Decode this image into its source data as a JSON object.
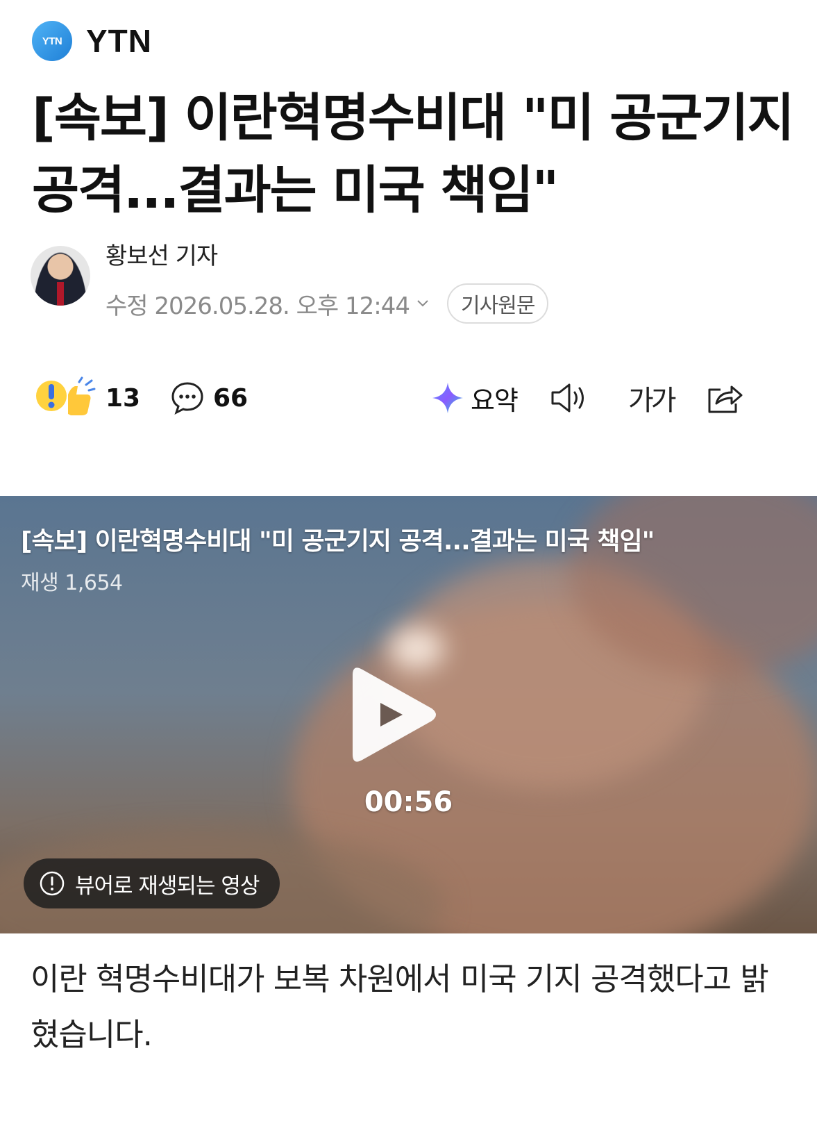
{
  "press": {
    "logo_text": "YTN",
    "name": "YTN",
    "brand_color": "#2a93e6"
  },
  "article": {
    "headline": "[속보] 이란혁명수비대 \"미 공군기지 공격...결과는 미국 책임\"",
    "reporter": "황보선 기자",
    "date": "수정 2026.05.28. 오후 12:44",
    "original_button": "기사원문",
    "body": "이란 혁명수비대가 보복 차원에서 미국 기지 공격했다고 밝혔습니다."
  },
  "actions": {
    "reaction_count": "13",
    "comment_count": "66",
    "summary_label": "요약",
    "font_size_label": "가가",
    "icons": [
      "reaction-icon",
      "comment-icon",
      "ai-summary-icon",
      "speaker-icon",
      "font-size-icon",
      "share-icon"
    ]
  },
  "video": {
    "title": "[속보] 이란혁명수비대 \"미 공군기지 공격...결과는 미국 책임\"",
    "plays": "재생 1,654",
    "duration": "00:56",
    "notice": "뷰어로 재생되는 영상"
  }
}
